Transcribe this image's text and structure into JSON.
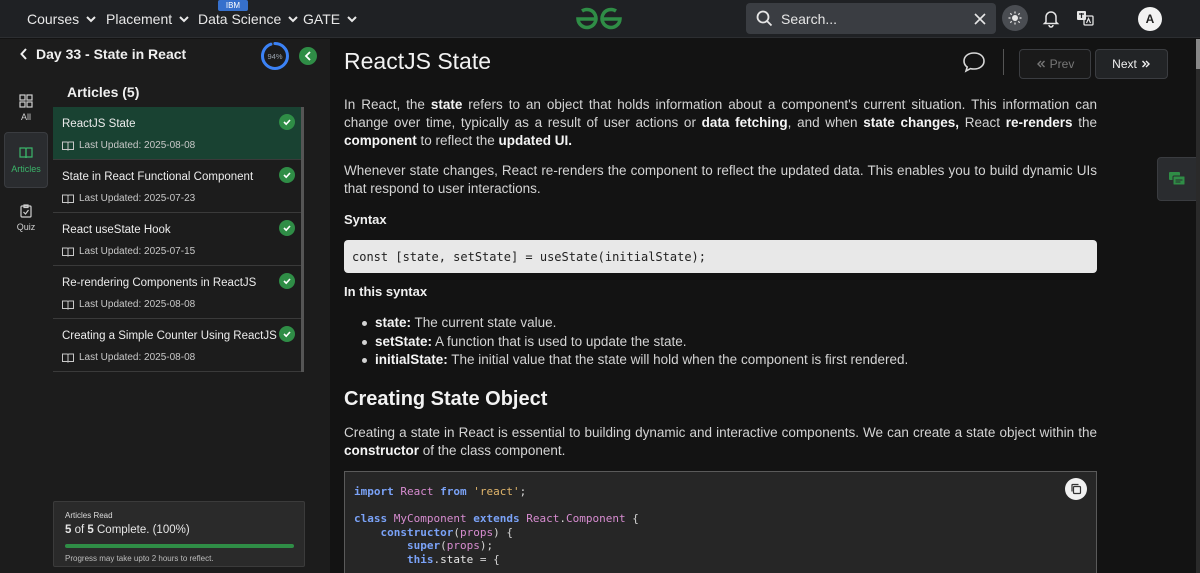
{
  "nav": {
    "courses": "Courses",
    "placement": "Placement",
    "data_science": "Data Science",
    "ibm_badge": "IBM",
    "gate": "GATE",
    "search_placeholder": "Search...",
    "avatar_initial": "A"
  },
  "sidebar": {
    "day_title": "Day 33 - State in React",
    "progress_percent": "94%",
    "progress_value": 0.94,
    "rail": [
      {
        "label": "All",
        "icon": "grid-icon"
      },
      {
        "label": "Articles",
        "icon": "book-icon"
      },
      {
        "label": "Quiz",
        "icon": "clipboard-icon"
      }
    ],
    "articles_header": "Articles (5)",
    "articles": [
      {
        "title": "ReactJS State",
        "updated": "Last Updated: 2025-08-08"
      },
      {
        "title": "State in React Functional Component",
        "updated": "Last Updated: 2025-07-23"
      },
      {
        "title": "React useState Hook",
        "updated": "Last Updated: 2025-07-15"
      },
      {
        "title": "Re-rendering Components in ReactJS",
        "updated": "Last Updated: 2025-08-08"
      },
      {
        "title": "Creating a Simple Counter Using ReactJS",
        "updated": "Last Updated: 2025-08-08"
      }
    ],
    "progress_card": {
      "label": "Articles Read",
      "done": "5",
      "of": " of ",
      "total": "5",
      "suffix": " Complete. (100%)",
      "fill_percent": 100,
      "note": "Progress may take upto 2 hours to reflect."
    }
  },
  "article": {
    "title": "ReactJS State",
    "prev": "Prev",
    "next": "Next",
    "syntax_heading": "Syntax",
    "syntax_code": "const [state, setState] = useState(initialState);",
    "in_syntax_heading": "In this syntax",
    "bullets": [
      {
        "term": "state:",
        "text": " The current state value."
      },
      {
        "term": "setState:",
        "text": " A function that is used to update the state."
      },
      {
        "term": "initialState:",
        "text": " The initial value that the state will hold when the component is first rendered."
      }
    ],
    "section_heading": "Creating State Object"
  },
  "colors": {
    "accent_green": "#2f8d46",
    "active_item_bg": "#194232",
    "nav_bg": "#1f2124"
  }
}
